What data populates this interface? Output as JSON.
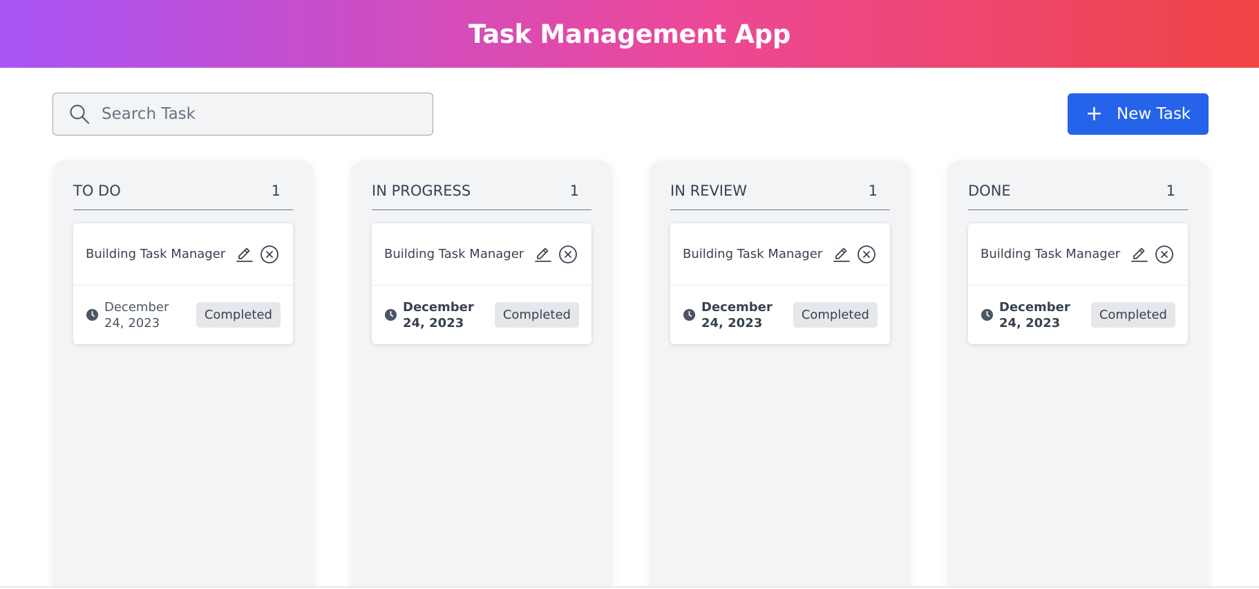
{
  "header": {
    "title": "Task Management App"
  },
  "search": {
    "placeholder": "Search Task",
    "value": ""
  },
  "toolbar": {
    "new_task_icon": "+",
    "new_task_label": "New Task"
  },
  "colors": {
    "accent": "#2563eb",
    "header_gradient": [
      "#a855f7",
      "#ec4899",
      "#ef4444"
    ],
    "column_bg": "#f3f4f6"
  },
  "columns": [
    {
      "title": "TO DO",
      "count": "1",
      "cards": [
        {
          "title": "Building Task Manager",
          "date": "December 24, 2023",
          "status": "Completed"
        }
      ]
    },
    {
      "title": "IN PROGRESS",
      "count": "1",
      "cards": [
        {
          "title": "Building Task Manager",
          "date": "December 24, 2023",
          "status": "Completed"
        }
      ]
    },
    {
      "title": "IN REVIEW",
      "count": "1",
      "cards": [
        {
          "title": "Building Task Manager",
          "date": "December 24, 2023",
          "status": "Completed"
        }
      ]
    },
    {
      "title": "DONE",
      "count": "1",
      "cards": [
        {
          "title": "Building Task Manager",
          "date": "December 24, 2023",
          "status": "Completed"
        }
      ]
    }
  ],
  "icons": {
    "search": "search-icon",
    "edit": "pencil-icon",
    "delete": "close-circle-icon",
    "date": "clock-icon",
    "add": "plus-icon"
  }
}
